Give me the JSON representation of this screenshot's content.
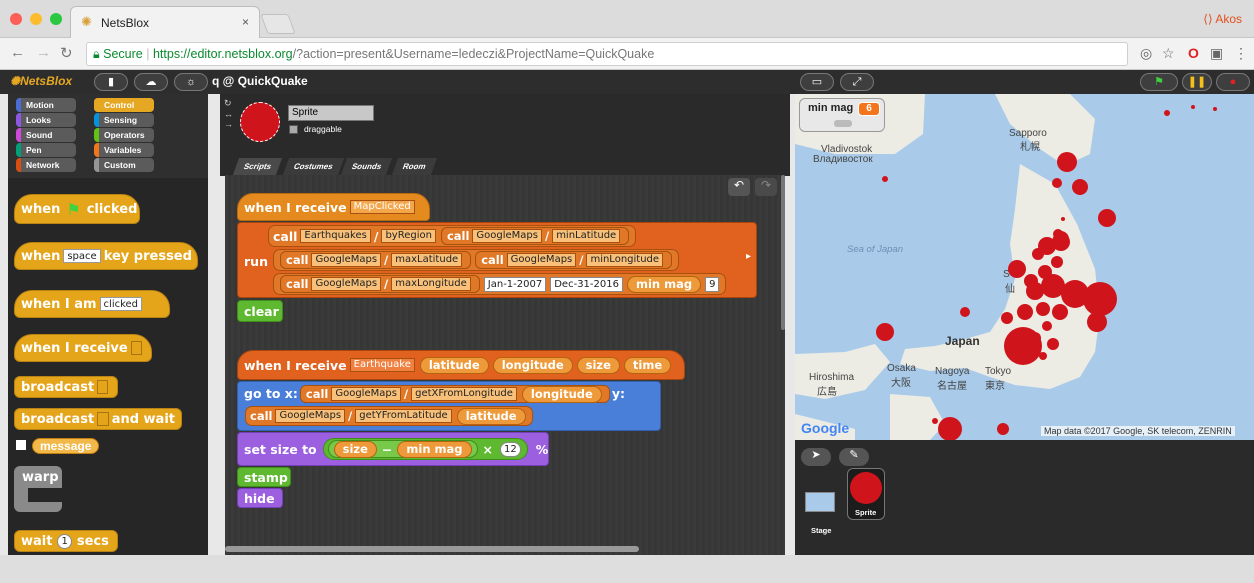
{
  "browser": {
    "tab_title": "NetsBlox",
    "tab_close": "×",
    "profile": "Akos",
    "secure": "Secure",
    "url_host": "https://editor.netsblox.org",
    "url_rest": "/?action=present&Username=ledeczi&ProjectName=QuickQuake"
  },
  "app": {
    "logo_text": "NetsBlox",
    "project_title": "q @ QuickQuake"
  },
  "categories": [
    {
      "label": "Motion",
      "color": "#4a6cd4"
    },
    {
      "label": "Control",
      "color": "#e6a822"
    },
    {
      "label": "Looks",
      "color": "#8f56e3"
    },
    {
      "label": "Sensing",
      "color": "#0494dc"
    },
    {
      "label": "Sound",
      "color": "#cf4ad9"
    },
    {
      "label": "Operators",
      "color": "#62c213"
    },
    {
      "label": "Pen",
      "color": "#00a178"
    },
    {
      "label": "Variables",
      "color": "#f3761d"
    },
    {
      "label": "Network",
      "color": "#d94d11"
    },
    {
      "label": "Custom",
      "color": "#969696"
    }
  ],
  "palette": {
    "when_flag": "when",
    "clicked": "clicked",
    "when_key": "when",
    "space": "space",
    "key_pressed": "key pressed",
    "when_i_am": "when I am",
    "clicked_opt": "clicked",
    "when_receive": "when I receive",
    "broadcast": "broadcast",
    "broadcast_wait": "broadcast",
    "and_wait": "and wait",
    "message": "message",
    "warp": "warp",
    "wait": "wait",
    "wait_val": "1",
    "secs": "secs"
  },
  "sprite": {
    "name": "Sprite",
    "draggable": "draggable"
  },
  "tabs": [
    "Scripts",
    "Costumes",
    "Sounds",
    "Room"
  ],
  "script1": {
    "hat": "when I receive",
    "msg": "MapClicked",
    "run": "run",
    "call": "call",
    "svc1": "Earthquakes",
    "slash": "/",
    "rpc1": "byRegion",
    "svc2": "GoogleMaps",
    "rpc_minlat": "minLatitude",
    "rpc_maxlat": "maxLatitude",
    "rpc_minlon": "minLongitude",
    "rpc_maxlon": "maxLongitude",
    "date1": "Jan-1-2007",
    "date2": "Dec-31-2016",
    "var_minmag": "min mag",
    "limit": "9",
    "clear": "clear"
  },
  "script2": {
    "hat": "when I receive",
    "msg": "Earthquake",
    "p1": "latitude",
    "p2": "longitude",
    "p3": "size",
    "p4": "time",
    "goto": "go to x:",
    "y": "y:",
    "call": "call",
    "svc": "GoogleMaps",
    "slash": "/",
    "rpc_x": "getXFromLongitude",
    "rpc_y": "getYFromLatitude",
    "set_size": "set size to",
    "minus": "−",
    "times": "×",
    "factor": "12",
    "pct": "%",
    "stamp": "stamp",
    "hide": "hide"
  },
  "stage": {
    "watcher_label": "min mag",
    "watcher_value": "6",
    "places": [
      {
        "name": "Sapporo"
      },
      {
        "name": "札幌"
      },
      {
        "name": "Vladivostok"
      },
      {
        "name": "Владивосток"
      },
      {
        "name": "Sea of Japan"
      },
      {
        "name": "Japan"
      },
      {
        "name": "Osaka"
      },
      {
        "name": "大阪"
      },
      {
        "name": "Nagoya"
      },
      {
        "name": "名古屋"
      },
      {
        "name": "Tokyo"
      },
      {
        "name": "東京"
      },
      {
        "name": "Hiroshima"
      },
      {
        "name": "広島"
      },
      {
        "name": "S"
      },
      {
        "name": "仙"
      }
    ],
    "google": "Google",
    "attribution": "Map data ©2017 Google, SK telecom, ZENRIN"
  },
  "corral": {
    "stage_label": "Stage",
    "sprite_label": "Sprite"
  },
  "colors": {
    "quake": "#d0141c",
    "control": "#e5a51b",
    "network": "#e0621e",
    "motion": "#4a7fd9",
    "looks": "#9b5fe0",
    "operators": "#5fb930"
  }
}
